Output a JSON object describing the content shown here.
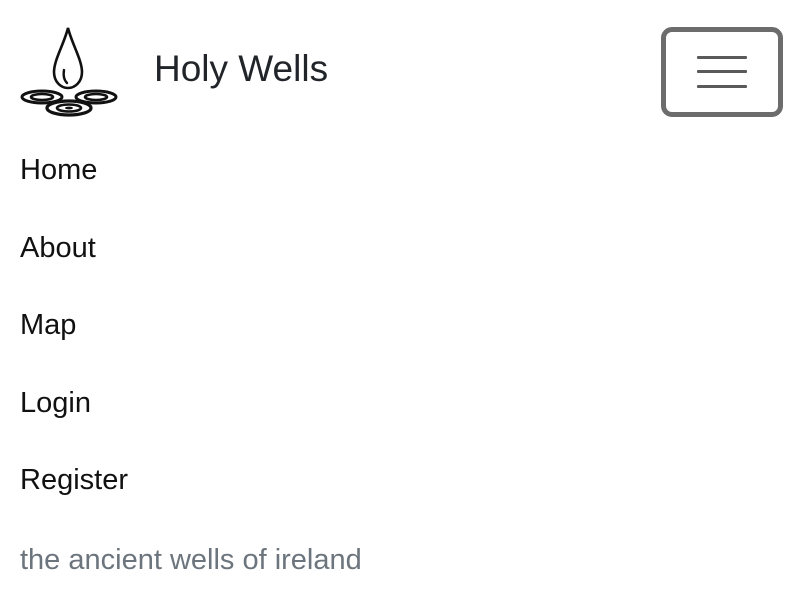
{
  "brand": {
    "title": "Holy Wells",
    "logo_icon": "water-drop-swirls-logo"
  },
  "toggler": {
    "icon": "hamburger-menu-icon"
  },
  "nav": {
    "items": [
      {
        "label": "Home"
      },
      {
        "label": "About"
      },
      {
        "label": "Map"
      },
      {
        "label": "Login"
      },
      {
        "label": "Register"
      }
    ]
  },
  "tagline": "the ancient wells of ireland",
  "colors": {
    "text": "#212529",
    "muted": "#6c757d",
    "toggler_border": "#6c6c6c"
  }
}
